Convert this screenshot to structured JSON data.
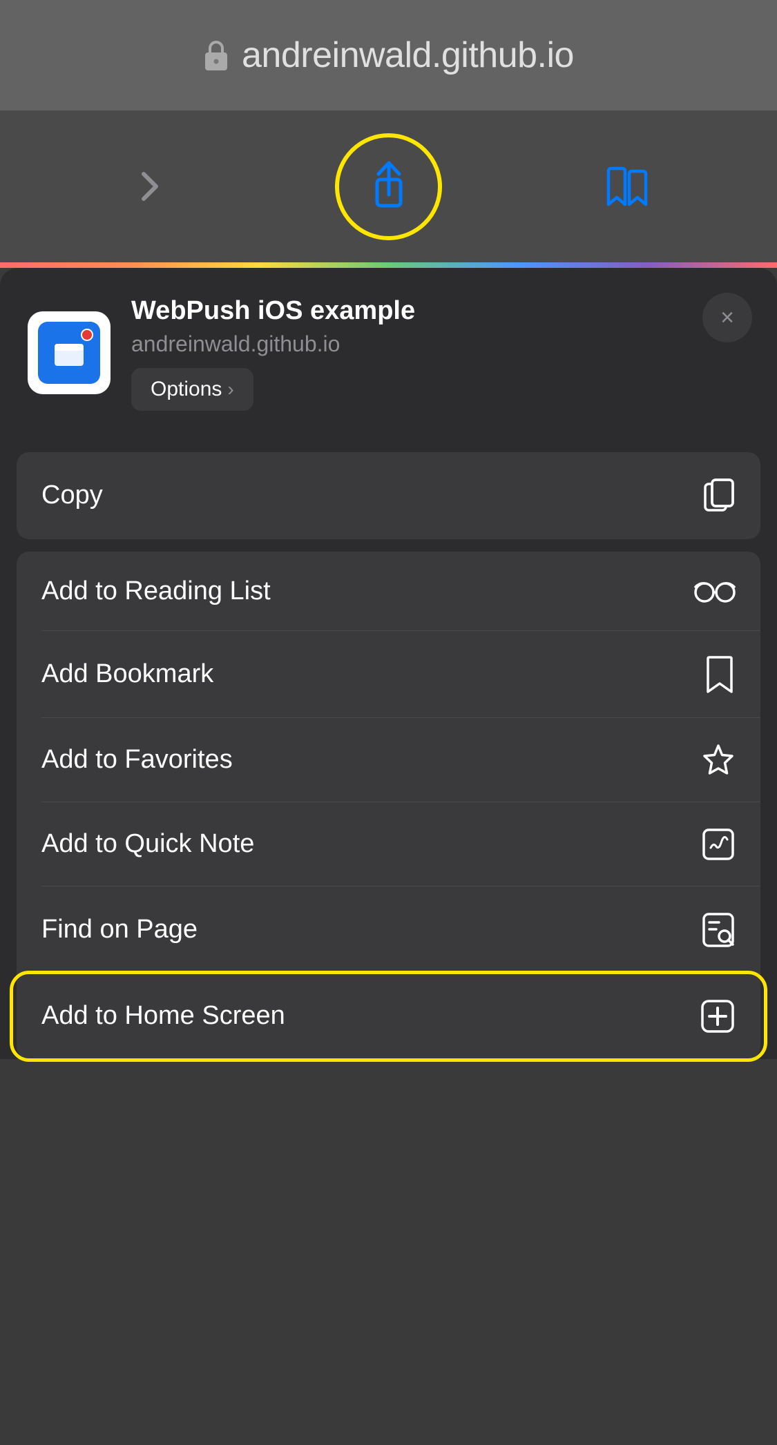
{
  "urlbar": {
    "url": "andreinwald.github.io",
    "lock_icon": "lock"
  },
  "toolbar": {
    "forward_label": "›",
    "share_label": "share",
    "bookmarks_label": "bookmarks"
  },
  "share_sheet": {
    "app_title": "WebPush iOS example",
    "app_url": "andreinwald.github.io",
    "options_label": "Options",
    "options_chevron": "›",
    "close_label": "×",
    "copy_label": "Copy",
    "menu_items": [
      {
        "label": "Add to Reading List",
        "icon": "reading-list"
      },
      {
        "label": "Add Bookmark",
        "icon": "bookmark"
      },
      {
        "label": "Add to Favorites",
        "icon": "star"
      },
      {
        "label": "Add to Quick Note",
        "icon": "quick-note"
      },
      {
        "label": "Find on Page",
        "icon": "find"
      },
      {
        "label": "Add to Home Screen",
        "icon": "add-home",
        "highlighted": true
      }
    ]
  },
  "colors": {
    "yellow_highlight": "#FFE600",
    "background": "#2c2c2e",
    "row_bg": "#3a3a3c",
    "accent_blue": "#007AFF"
  }
}
